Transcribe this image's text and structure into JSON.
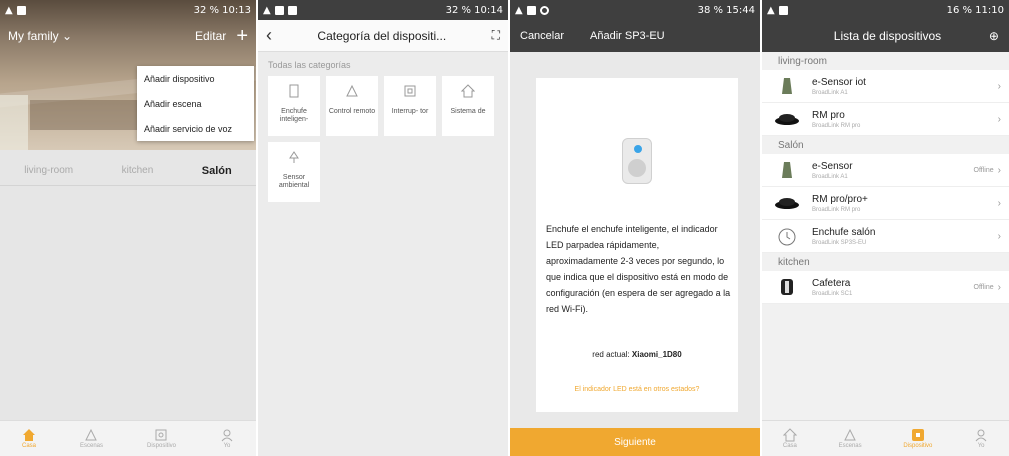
{
  "panel1": {
    "status_time": "10:13",
    "status_battery": "32 %",
    "home_name": "My family",
    "edit_label": "Editar",
    "menu": [
      "Añadir dispositivo",
      "Añadir escena",
      "Añadir servicio de voz"
    ],
    "rooms": [
      "living-room",
      "kitchen",
      "Salón"
    ],
    "nav": [
      "Casa",
      "Escenas",
      "Dispositivo",
      "Yo"
    ]
  },
  "panel2": {
    "status_time": "10:14",
    "status_battery": "32 %",
    "title": "Categoría del dispositi...",
    "subtitle": "Todas las categorías",
    "tiles": [
      "Enchufe inteligen-",
      "Control remoto",
      "Interrup- tor",
      "Sistema de",
      "Sensor ambiental"
    ]
  },
  "panel3": {
    "status_time": "15:44",
    "status_battery": "38 %",
    "cancel_label": "Cancelar",
    "title": "Añadir SP3-EU",
    "description": "Enchufe el enchufe inteligente, el indicador LED parpadea rápidamente, aproximadamente 2-3 veces por segundo, lo que indica que el dispositivo está en modo de configuración (en espera de ser agregado a la red Wi-Fi).",
    "network_label": "red actual:",
    "network_value": "Xiaomi_1D80",
    "led_link": "El indicador LED está en otros estados?",
    "next_label": "Siguiente"
  },
  "panel4": {
    "status_time": "11:10",
    "status_battery": "16 %",
    "title": "Lista de dispositivos",
    "sections": [
      {
        "name": "living-room",
        "devices": [
          {
            "name": "e-Sensor iot",
            "model": "BroadLink A1",
            "status": ""
          },
          {
            "name": "RM pro",
            "model": "BroadLink RM pro",
            "status": ""
          }
        ]
      },
      {
        "name": "Salón",
        "devices": [
          {
            "name": "e-Sensor",
            "model": "BroadLink A1",
            "status": "Offline"
          },
          {
            "name": "RM pro/pro+",
            "model": "BroadLink RM pro",
            "status": ""
          },
          {
            "name": "Enchufe salón",
            "model": "BroadLink SP3S-EU",
            "status": ""
          }
        ]
      },
      {
        "name": "kitchen",
        "devices": [
          {
            "name": "Cafetera",
            "model": "BroadLink SC1",
            "status": "Offline"
          }
        ]
      }
    ],
    "nav": [
      "Casa",
      "Escenas",
      "Dispositivo",
      "Yo"
    ]
  },
  "colors": {
    "accent": "#f0a830",
    "header_dark": "#3f3f3f",
    "led_blue": "#3aa4e8"
  }
}
